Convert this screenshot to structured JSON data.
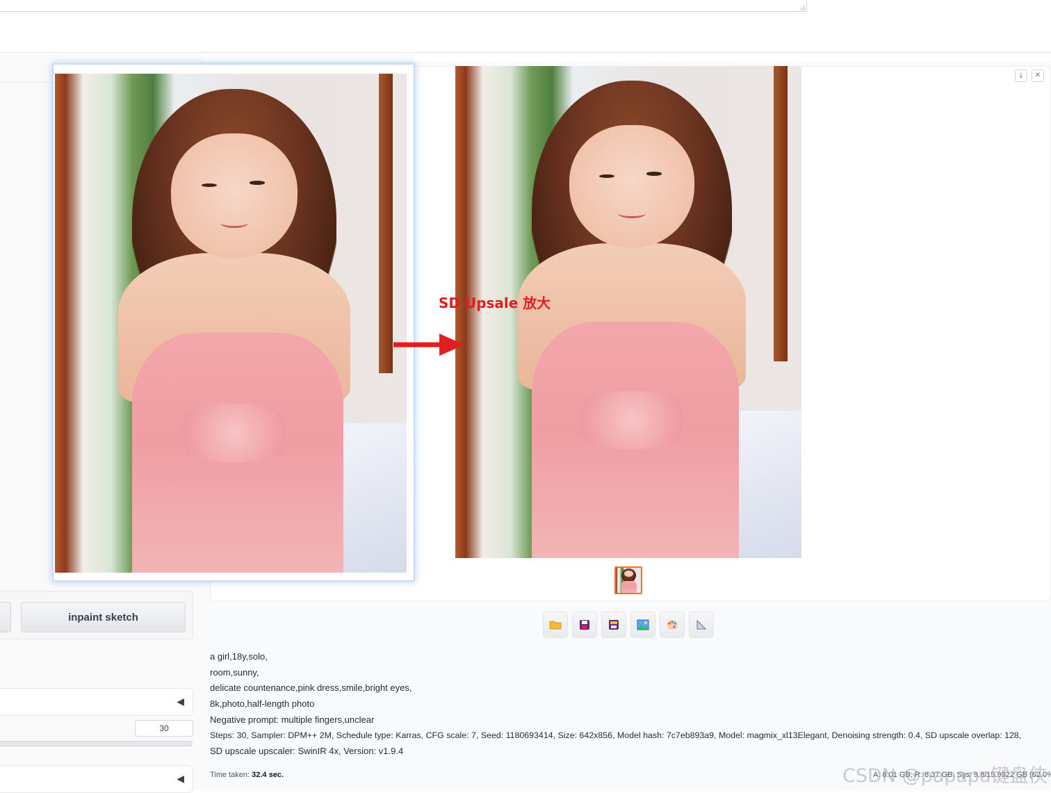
{
  "left_panel": {
    "inpaint_sketch_label": "inpaint sketch",
    "accordion_arrow": "◀",
    "steps_value": "30"
  },
  "annotation": {
    "label": "SD Upsale  放大",
    "color": "#e02020"
  },
  "gallery": {
    "download_icon": "download-icon",
    "close_icon": "close-icon"
  },
  "actions": [
    {
      "icon": "folder-icon"
    },
    {
      "icon": "save-icon"
    },
    {
      "icon": "zip-icon"
    },
    {
      "icon": "send-to-img2img-icon"
    },
    {
      "icon": "send-to-inpaint-icon"
    },
    {
      "icon": "send-to-extras-icon"
    }
  ],
  "generation_info": {
    "line1": "a girl,18y,solo,",
    "line2": "room,sunny,",
    "line3": "delicate countenance,pink dress,smile,bright eyes,",
    "line4": "8k,photo,half-length photo",
    "line5": "Negative prompt: multiple fingers,unclear",
    "line6": "Steps: 30, Sampler: DPM++ 2M, Schedule type: Karras, CFG scale: 7, Seed: 1180693414, Size: 642x856, Model hash: 7c7eb893a9, Model: magmix_xl13Elegant, Denoising strength: 0.4, SD upscale overlap: 128,",
    "line7": "SD upscale upscaler: SwinIR 4x, Version: v1.9.4"
  },
  "timing": {
    "label": "Time taken:",
    "value": "32.4 sec.",
    "vram": "A: 8.01 GB, R: 8.37 GB, Sys: 9.8/15.9922 GB (62.0%)"
  },
  "watermark": "CSDN @papapa键盘侠"
}
